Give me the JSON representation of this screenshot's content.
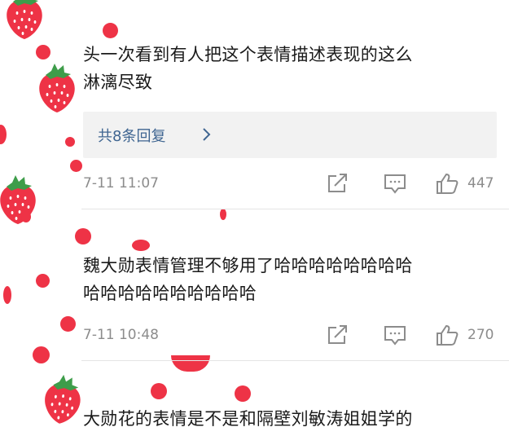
{
  "theme": {
    "accent": "#3f6591",
    "decor_red": "#ee3346",
    "meta_gray": "#8c8c8c",
    "reply_bg": "#f2f2f2"
  },
  "comments": [
    {
      "text_line1": "头一次看到有人把这个表情描述表现的这么",
      "text_line2": "淋漓尽致",
      "replies_label": "共8条回复",
      "replies_icon": "chevron-right-icon",
      "timestamp": "7-11 11:07",
      "share_icon": "share-icon",
      "comment_icon": "comment-icon",
      "like_icon": "thumbs-up-icon",
      "likes": "447"
    },
    {
      "text_line1": "魏大勋表情管理不够用了哈哈哈哈哈哈哈哈",
      "text_line2": "哈哈哈哈哈哈哈哈哈哈",
      "timestamp": "7-11 10:48",
      "share_icon": "share-icon",
      "comment_icon": "comment-icon",
      "like_icon": "thumbs-up-icon",
      "likes": "270"
    },
    {
      "text_line1": "大勋花的表情是不是和隔壁刘敏涛姐姐学的"
    }
  ],
  "decorations": {
    "avatar_frame": "strawberry-polka-dot-frame",
    "avatar_icon": "strawberry-icon"
  }
}
